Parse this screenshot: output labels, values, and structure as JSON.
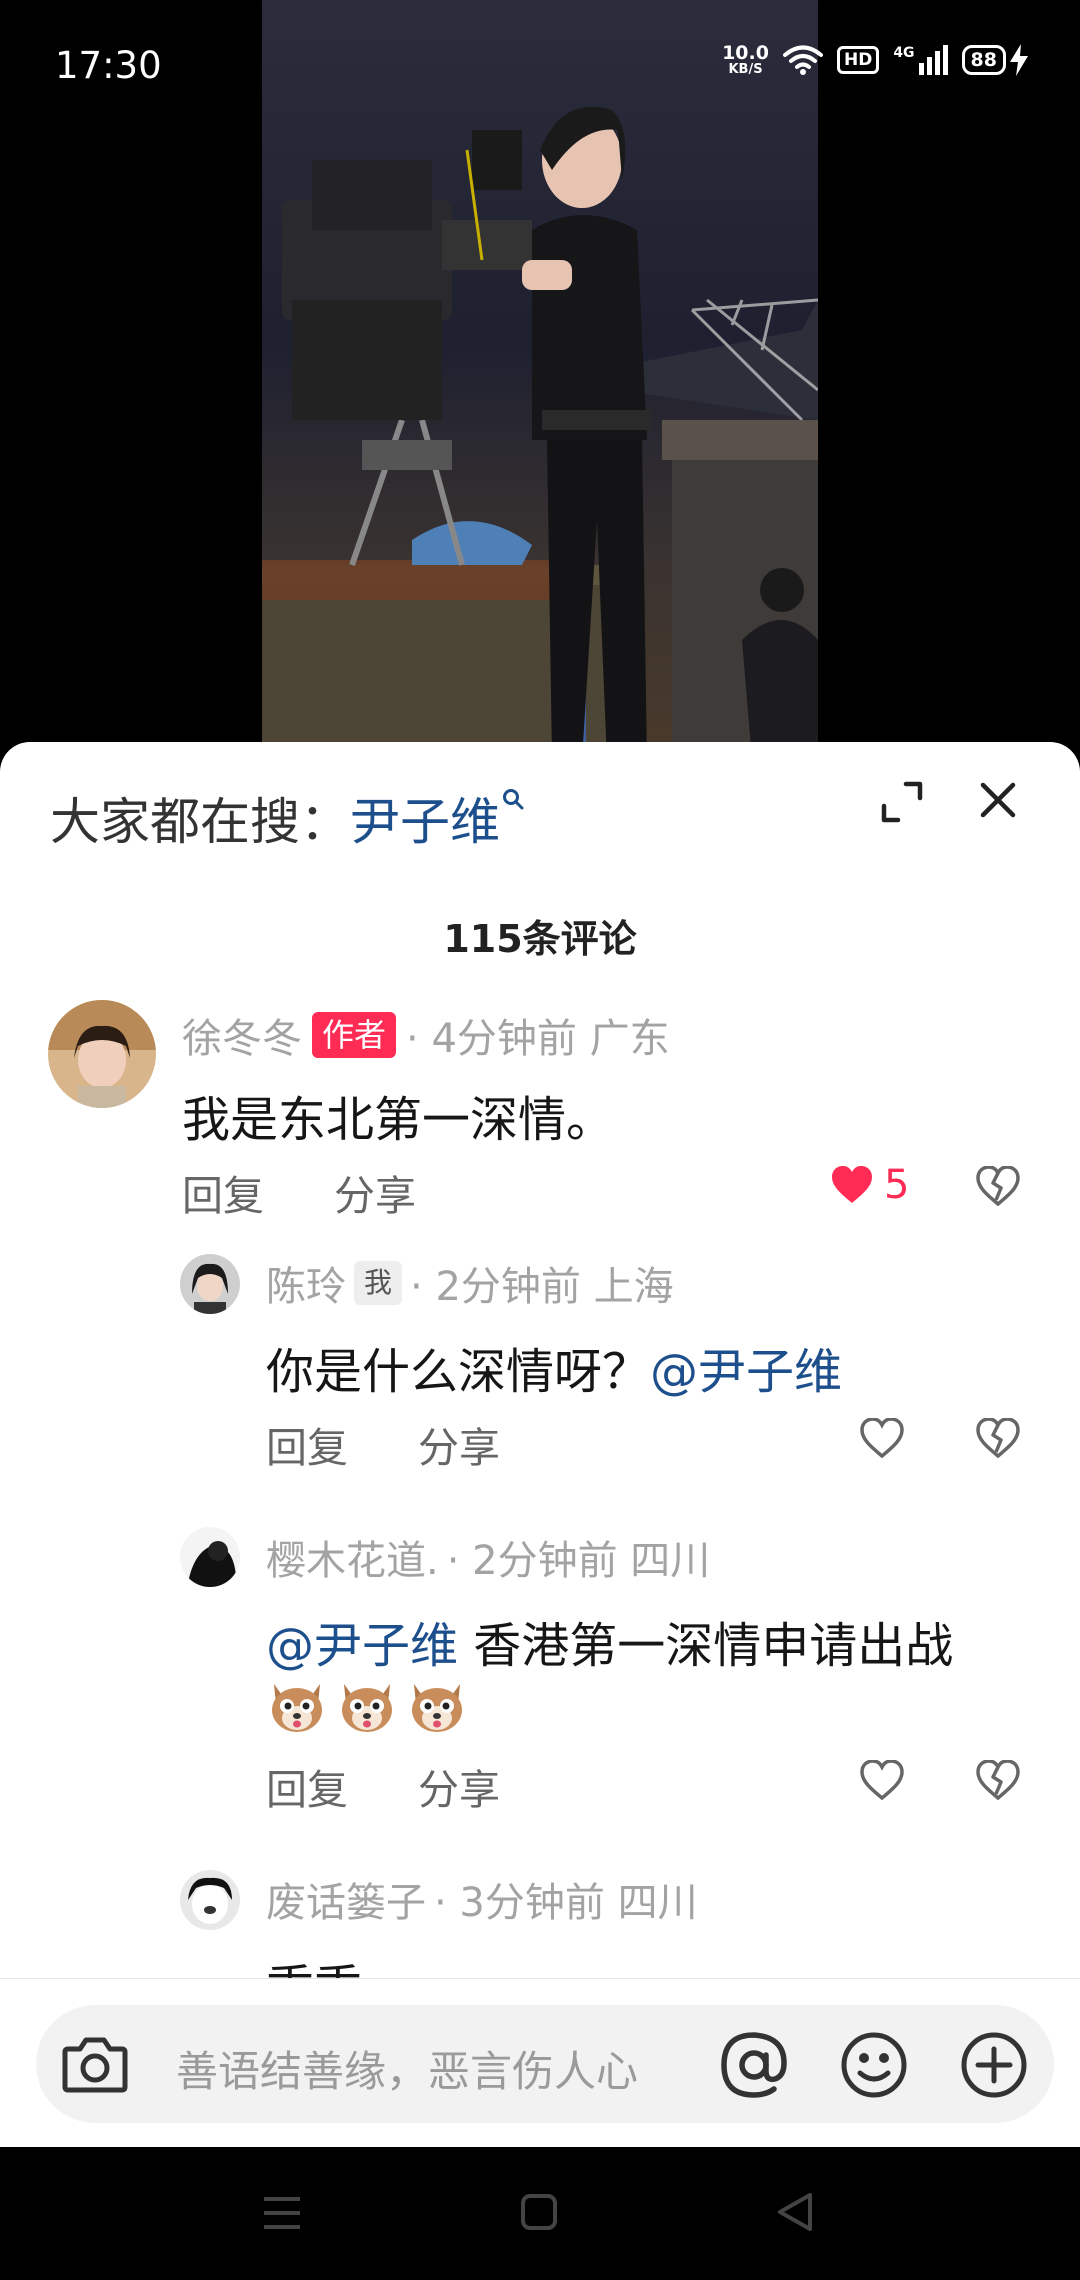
{
  "status_bar": {
    "time": "17:30",
    "net_speed_value": "10.0",
    "net_speed_unit": "KB/S",
    "hd_label": "HD",
    "network_label": "4G",
    "battery_level": "88"
  },
  "sheet": {
    "search_prefix": "大家都在搜：",
    "search_term": "尹子维",
    "comment_count": "115条评论"
  },
  "comments": [
    {
      "name": "徐冬冬",
      "badge": "作者",
      "meta": "· 4分钟前 广东",
      "text": "我是东北第一深情。",
      "reply_label": "回复",
      "share_label": "分享",
      "likes": "5",
      "liked": true
    },
    {
      "name": "陈玲",
      "badge": "我",
      "meta": "· 2分钟前 上海",
      "text": "你是什么深情呀？",
      "mention": "@尹子维",
      "reply_label": "回复",
      "share_label": "分享",
      "liked": false
    },
    {
      "name": "樱木花道.",
      "meta": "· 2分钟前 四川",
      "mention": "@尹子维",
      "text": " 香港第一深情申请出战",
      "emoji_count": 3,
      "reply_label": "回复",
      "share_label": "分享",
      "liked": false
    },
    {
      "name": "废话篓子",
      "meta": "· 3分钟前 四川",
      "text": "乖乖"
    }
  ],
  "input": {
    "placeholder": "善语结善缘，恶言伤人心"
  },
  "colors": {
    "accent_red": "#fe2c55",
    "mention_blue": "#1d4f8c"
  }
}
